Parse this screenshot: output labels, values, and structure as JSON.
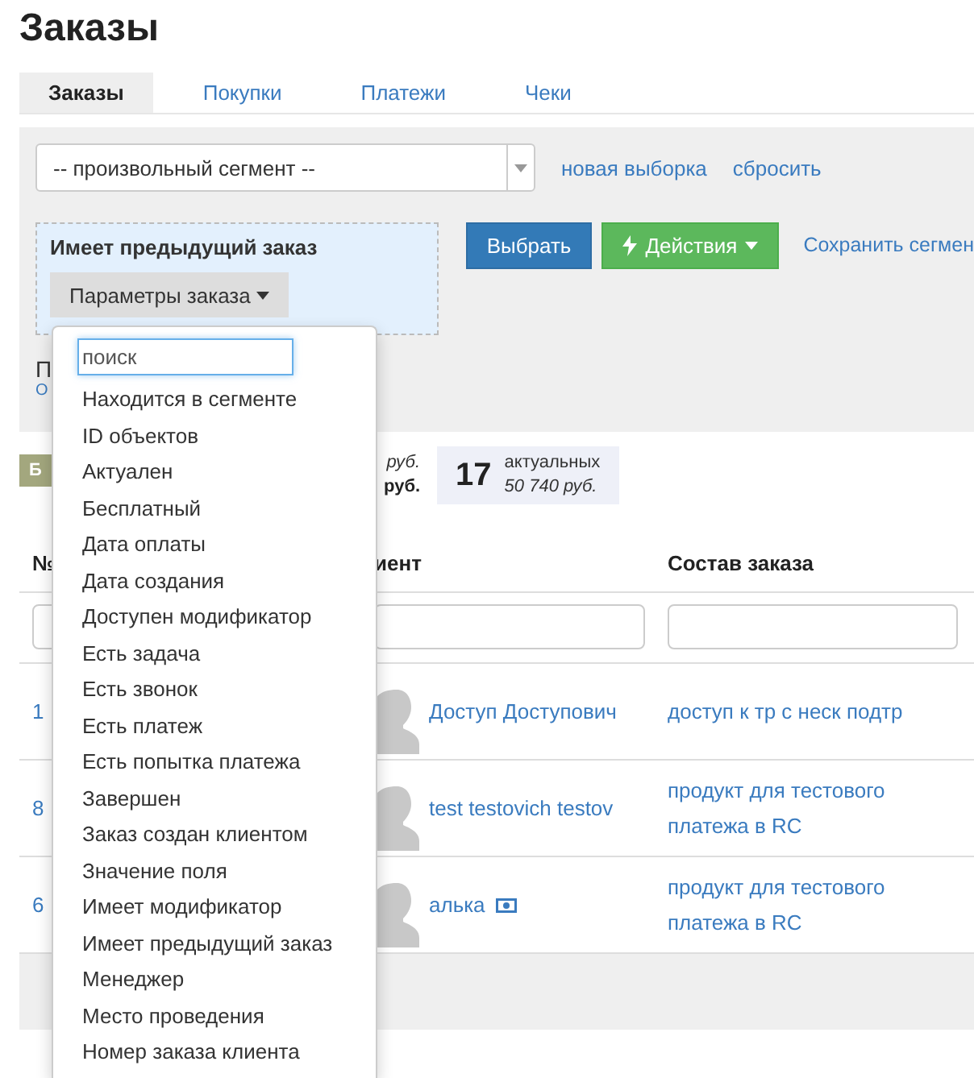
{
  "page_title": "Заказы",
  "tabs": [
    {
      "label": "Заказы",
      "selected": true
    },
    {
      "label": "Покупки",
      "selected": false
    },
    {
      "label": "Платежи",
      "selected": false
    },
    {
      "label": "Чеки",
      "selected": false
    }
  ],
  "segment_select": {
    "value": "-- произвольный сегмент --"
  },
  "segment_links": [
    "новая выборка",
    "сбросить"
  ],
  "condition": {
    "title": "Имеет предыдущий заказ",
    "button": "Параметры заказа"
  },
  "buttons": [
    {
      "label": "Выбрать",
      "kind": "primary"
    },
    {
      "label": "Действия",
      "kind": "actions"
    }
  ],
  "save_link": "Сохранить сегмен",
  "filter_note": {
    "title": "П",
    "link": "О"
  },
  "stats": {
    "badge": "Б",
    "sum_1": "руб.",
    "sum_2": "руб.",
    "actual": {
      "count": "17",
      "label": "актуальных",
      "sum": "50 740 руб."
    }
  },
  "table": {
    "columns": [
      "№",
      "иент",
      "Состав заказа"
    ],
    "rows": [
      {
        "number": "1",
        "client": "Доступ Доступович",
        "money_badge": false,
        "items": "доступ к тр с неск подтр"
      },
      {
        "number": "8",
        "client": "test testovich testov",
        "money_badge": false,
        "items": "продукт для тестового платежа в RC"
      },
      {
        "number": "6",
        "client": "алька",
        "money_badge": true,
        "items": "продукт для тестового платежа в RC"
      }
    ]
  },
  "dropdown": {
    "search_placeholder": "поиск",
    "items": [
      "Находится в сегменте",
      "ID объектов",
      "Актуален",
      "Бесплатный",
      "Дата оплаты",
      "Дата создания",
      "Доступен модификатор",
      "Есть задача",
      "Есть звонок",
      "Есть платеж",
      "Есть попытка платежа",
      "Завершен",
      "Заказ создан клиентом",
      "Значение поля",
      "Имеет модификатор",
      "Имеет предыдущий заказ",
      "Менеджер",
      "Место проведения",
      "Номер заказа клиента"
    ]
  }
}
